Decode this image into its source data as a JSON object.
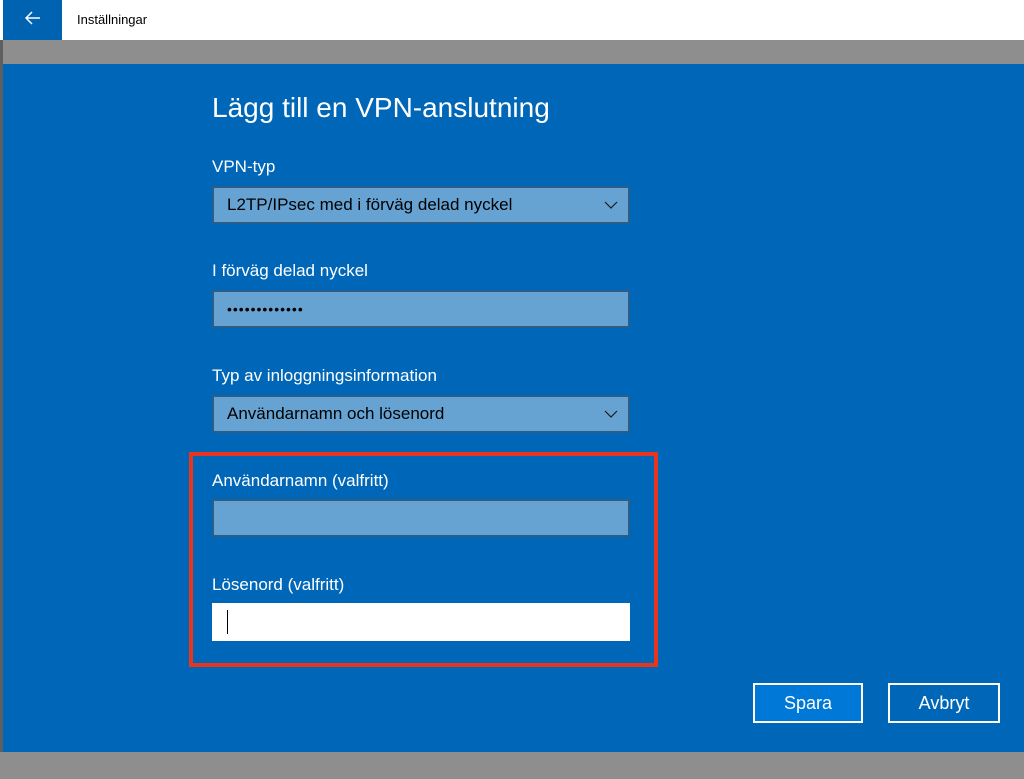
{
  "titlebar": {
    "title": "Inställningar",
    "back_icon": "back-arrow-icon"
  },
  "form": {
    "heading": "Lägg till en VPN-anslutning",
    "vpn_type": {
      "label": "VPN-typ",
      "value": "L2TP/IPsec med i förväg delad nyckel"
    },
    "preshared_key": {
      "label": "I förväg delad nyckel",
      "value": "•••••••••••••"
    },
    "signin_type": {
      "label": "Typ av inloggningsinformation",
      "value": "Användarnamn och lösenord"
    },
    "username": {
      "label": "Användarnamn (valfritt)",
      "value": ""
    },
    "password": {
      "label": "Lösenord (valfritt)",
      "value": ""
    }
  },
  "buttons": {
    "save": "Spara",
    "cancel": "Avbryt"
  },
  "colors": {
    "panel": "#0067b8",
    "accent": "#0078d7",
    "highlight": "#e8351d"
  }
}
